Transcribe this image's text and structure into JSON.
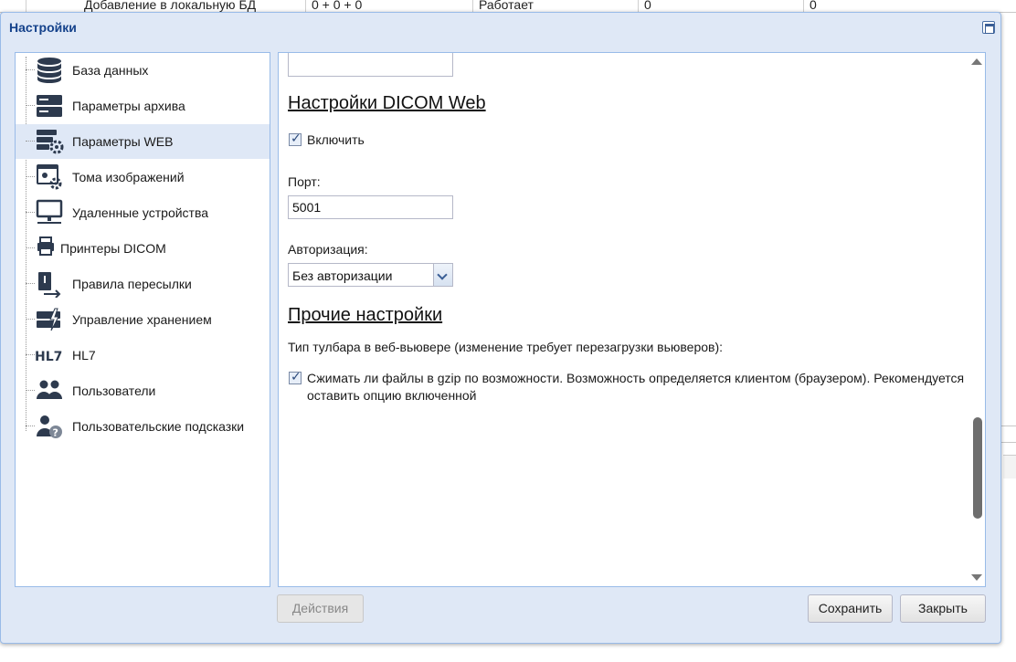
{
  "background": {
    "row": {
      "name": "Добавление в локальную БД",
      "value1": "0 + 0 + 0",
      "status": "Работает",
      "value2": "0",
      "value3": "0"
    }
  },
  "dialog": {
    "title": "Настройки"
  },
  "sidebar": {
    "items": [
      {
        "label": "База данных",
        "icon": "database-icon"
      },
      {
        "label": "Параметры архива",
        "icon": "server-icon"
      },
      {
        "label": "Параметры WEB",
        "icon": "web-server-gear-icon",
        "selected": true
      },
      {
        "label": "Тома изображений",
        "icon": "image-volume-gear-icon"
      },
      {
        "label": "Удаленные устройства",
        "icon": "monitor-network-icon"
      },
      {
        "label": "Принтеры DICOM",
        "icon": "printer-icon"
      },
      {
        "label": "Правила пересылки",
        "icon": "document-forward-icon"
      },
      {
        "label": "Управление хранением",
        "icon": "storage-lightning-icon"
      },
      {
        "label": "HL7",
        "icon": "hl7-icon"
      },
      {
        "label": "Пользователи",
        "icon": "users-icon"
      },
      {
        "label": "Пользовательские подсказки",
        "icon": "user-help-icon"
      }
    ]
  },
  "content": {
    "dicom_web": {
      "heading": "Настройки DICOM Web",
      "enable_label": "Включить",
      "enable_checked": true,
      "port_label": "Порт:",
      "port_value": "5001",
      "auth_label": "Авторизация:",
      "auth_value": "Без авторизации"
    },
    "other": {
      "heading": "Прочие настройки",
      "toolbar_label": "Тип тулбара в веб-вьювере (изменение требует перезагрузки вьюверов):",
      "gzip_label": "Сжимать ли файлы в gzip по возможности. Возможность определяется клиентом (браузером). Рекомендуется оставить опцию включенной",
      "gzip_checked": true
    },
    "scroll_position": 0.72
  },
  "footer": {
    "actions_label": "Действия",
    "save_label": "Сохранить",
    "close_label": "Закрыть"
  },
  "colors": {
    "dialog_bg": "#dfe8f6",
    "border": "#99bbe8",
    "title": "#15428b",
    "icon": "#2d3a4e"
  }
}
